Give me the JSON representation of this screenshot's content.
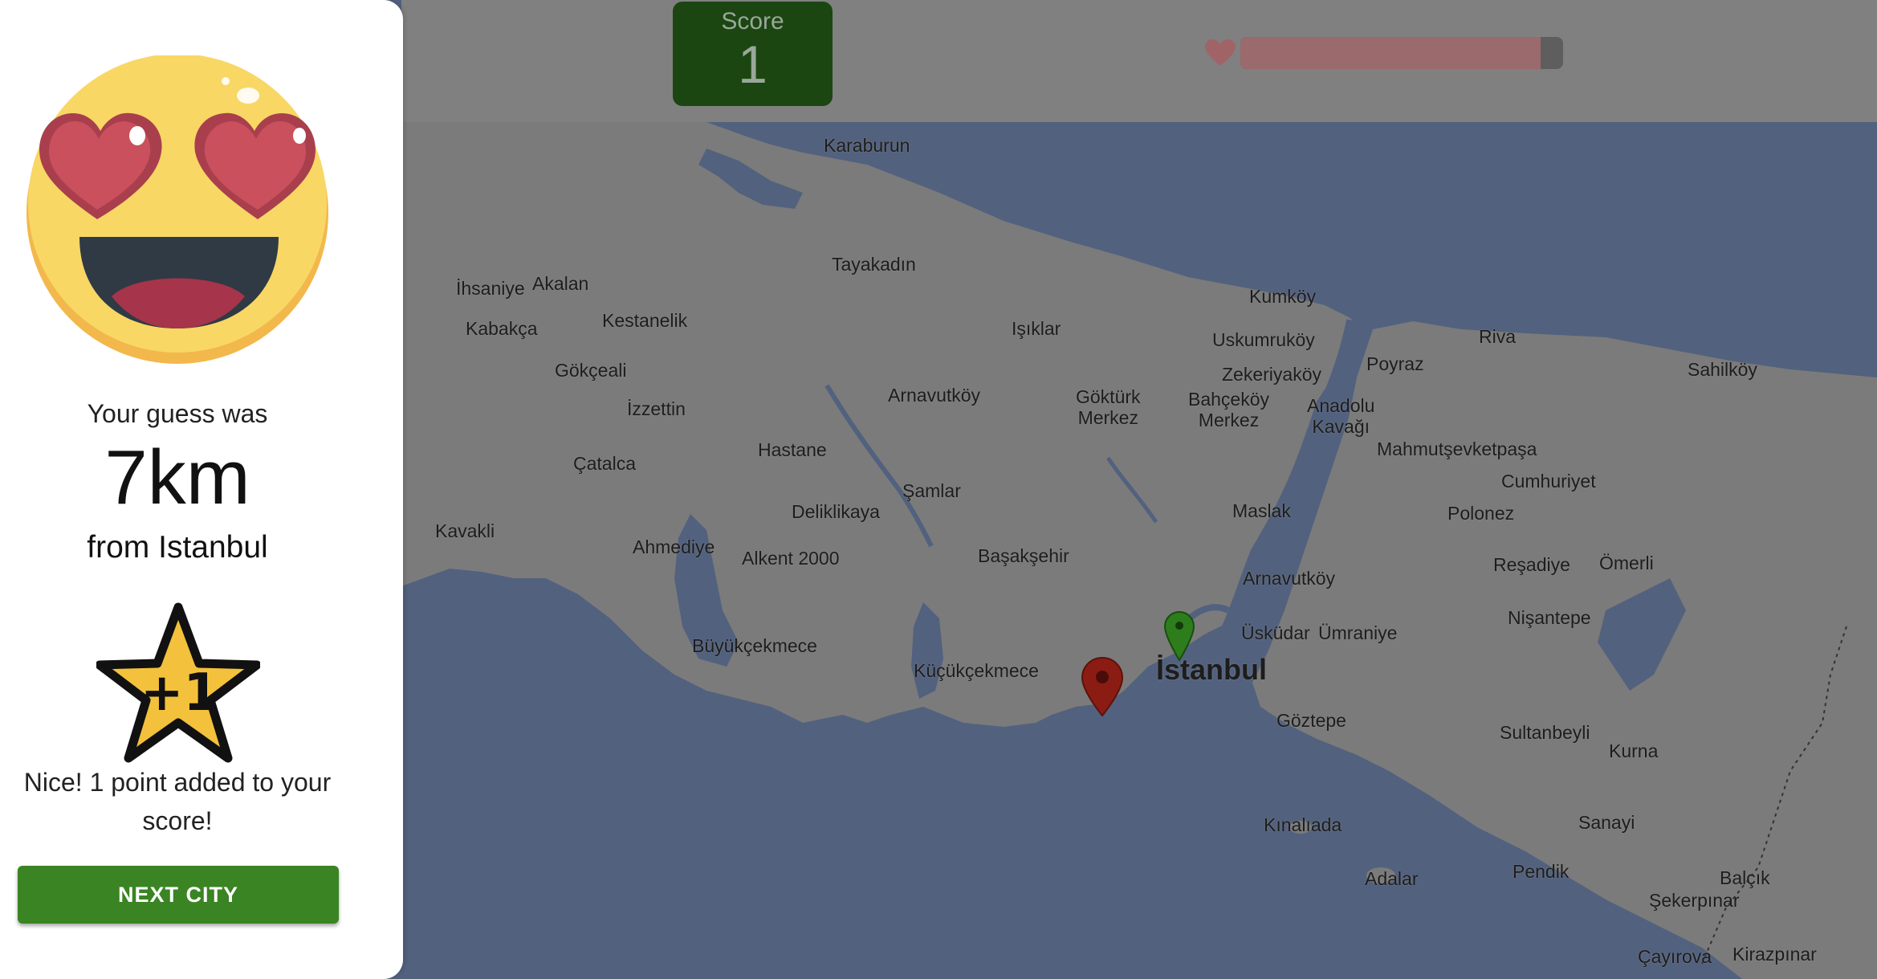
{
  "header": {
    "score_label": "Score",
    "score_value": "1",
    "health_fraction": 0.93
  },
  "result": {
    "guess_label": "Your guess was",
    "distance": "7km",
    "from_city": "from Istanbul",
    "reward_badge": "+1",
    "message": "Nice! 1 point added to your score!",
    "next_button": "NEXT CITY"
  },
  "map": {
    "places": [
      "Karaburun",
      "Tayakadın",
      "İhsaniye",
      "Akalan",
      "Kabakça",
      "Kestanelik",
      "Gökçeali",
      "İzzettin",
      "Çatalca",
      "Kavakli",
      "Hastane",
      "Arnavutköy",
      "Işıklar",
      "Kumköy",
      "Uskumruköy",
      "Zekeriyaköy",
      "Riva",
      "Sahilköy",
      "Göktürk\nMerkez",
      "Bahçeköy\nMerkez",
      "Poyraz",
      "Anadolu\nKavağı",
      "Mahmutşevketpaşa",
      "Cumhuriyet",
      "Polonez",
      "Şamlar",
      "Deliklikaya",
      "Maslak",
      "Ahmediye",
      "Alkent 2000",
      "Başakşehir",
      "Arnavutköy",
      "Reşadiye",
      "Ömerli",
      "Nişantepe",
      "Üsküdar",
      "Ümraniye",
      "Büyükçekmece",
      "Küçükçekmece",
      "İstanbul",
      "Göztepe",
      "Sultanbeyli",
      "Kurna",
      "Kınalıada",
      "Sanayi",
      "Adalar",
      "Pendik",
      "Balçık",
      "Şekerpınar",
      "Çayırova",
      "Kirazpınar"
    ],
    "markers": [
      {
        "name": "guess-marker",
        "color": "#8b1c14"
      },
      {
        "name": "target-marker",
        "color": "#2e7d1c"
      }
    ],
    "land_color": "#7b7b7b",
    "water_color": "#52617e"
  }
}
